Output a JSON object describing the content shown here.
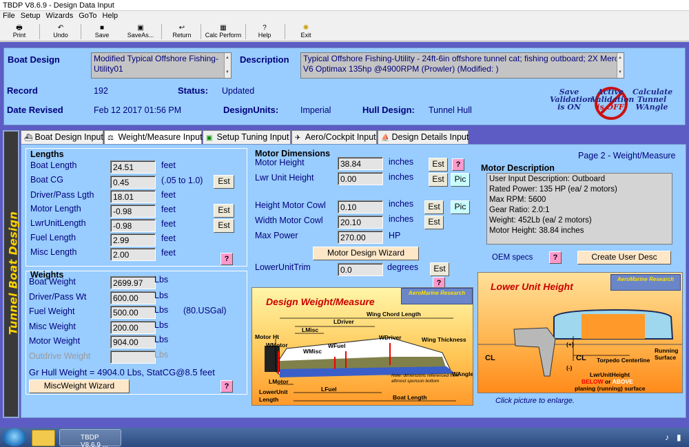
{
  "window": {
    "title": "TBDP V8.6.9 - Design Data Input"
  },
  "menu": [
    "File",
    "Setup",
    "Wizards",
    "GoTo",
    "Help"
  ],
  "toolbar": [
    {
      "label": "Print",
      "icon": "printer-icon",
      "glyph": "🖶"
    },
    {
      "label": "Undo",
      "icon": "undo-icon",
      "glyph": "↶"
    },
    {
      "label": "Save",
      "icon": "floppy-icon",
      "glyph": "■"
    },
    {
      "label": "SaveAs...",
      "icon": "save-as-icon",
      "glyph": "▣"
    },
    {
      "label": "Return",
      "icon": "return-icon",
      "glyph": "↩"
    },
    {
      "label": "Calc Perform",
      "icon": "calc-icon",
      "glyph": "▦"
    },
    {
      "label": "Help",
      "icon": "help-icon",
      "glyph": "?"
    },
    {
      "label": "Exit",
      "icon": "exit-icon",
      "glyph": "✺"
    }
  ],
  "header": {
    "boat_design_label": "Boat Design",
    "boat_design_value": "Modified Typical Offshore Fishing-Utility01",
    "description_label": "Description",
    "description_value": "Typical Offshore Fishing-Utility - 24ft-6in offshore tunnel cat; fishing outboard; 2X Merc V6 Optimax 135hp @4900RPM (Prowler) (Modified: )",
    "record_label": "Record",
    "record_value": "192",
    "status_label": "Status:",
    "status_value": "Updated",
    "date_label": "Date Revised",
    "date_value": "Feb 12 2017 01:56 PM",
    "units_label": "DesignUnits:",
    "units_value": "Imperial",
    "hull_label": "Hull Design:",
    "hull_value": "Tunnel Hull",
    "badges": [
      {
        "line1": "Save",
        "line2": "Validation",
        "line3": "is ON"
      },
      {
        "line1": "Active",
        "line2": "Validation",
        "line3": "is OFF"
      },
      {
        "line1": "Calculate",
        "line2": "Tunnel",
        "line3": "WAngle"
      }
    ]
  },
  "sidebar_title": "Tunnel Boat Design",
  "tabs": [
    {
      "label": "Boat Design Input",
      "icon": "boat-icon",
      "glyph": "⛴"
    },
    {
      "label": "Weight/Measure Input",
      "icon": "scale-icon",
      "glyph": "⚖"
    },
    {
      "label": "Setup Tuning Input",
      "icon": "tuning-icon",
      "glyph": "▣"
    },
    {
      "label": "Aero/Cockpit Input",
      "icon": "aero-icon",
      "glyph": "✈"
    },
    {
      "label": "Design Details Input",
      "icon": "details-icon",
      "glyph": "⛵"
    }
  ],
  "page_title": "Page 2 - Weight/Measure",
  "lengths": {
    "title": "Lengths",
    "rows": [
      {
        "label": "Boat Length",
        "value": "24.51",
        "unit": "feet",
        "btn": ""
      },
      {
        "label": "Boat CG",
        "value": "0.45",
        "unit": "(.05 to 1.0)",
        "btn": "Est"
      },
      {
        "label": "Driver/Pass Lgth",
        "value": "18.01",
        "unit": "feet",
        "btn": ""
      },
      {
        "label": "Motor Length",
        "value": "-0.98",
        "unit": "feet",
        "btn": "Est"
      },
      {
        "label": "LwrUnitLength",
        "value": "-0.98",
        "unit": "feet",
        "btn": "Est"
      },
      {
        "label": "Fuel Length",
        "value": "2.99",
        "unit": "feet",
        "btn": ""
      },
      {
        "label": "Misc Length",
        "value": "2.00",
        "unit": "feet",
        "btn": ""
      }
    ]
  },
  "weights": {
    "title": "Weights",
    "rows": [
      {
        "label": "Boat Weight",
        "value": "2699.97",
        "unit": "Lbs",
        "note": ""
      },
      {
        "label": "Driver/Pass Wt",
        "value": "600.00",
        "unit": "Lbs",
        "note": ""
      },
      {
        "label": "Fuel Weight",
        "value": "500.00",
        "unit": "Lbs",
        "note": "(80.USGal)"
      },
      {
        "label": "Misc Weight",
        "value": "200.00",
        "unit": "Lbs",
        "note": ""
      },
      {
        "label": "Motor Weight",
        "value": "904.00",
        "unit": "Lbs",
        "note": ""
      },
      {
        "label": "Outdrive Weight",
        "value": "",
        "unit": "Lbs",
        "note": ""
      }
    ],
    "summary": "Gr Hull Weight = 4904.0 Lbs, StatCG@8.5 feet",
    "wizard": "MiscWeight Wizard"
  },
  "motor": {
    "title": "Motor Dimensions",
    "height_label": "Motor Height",
    "height_value": "38.84",
    "height_unit": "inches",
    "lwr_label": "Lwr Unit Height",
    "lwr_value": "0.00",
    "lwr_unit": "inches",
    "cowlh_label": "Height Motor Cowl",
    "cowlh_value": "0.10",
    "cowlh_unit": "inches",
    "cowlw_label": "Width Motor Cowl",
    "cowlw_value": "20.10",
    "cowlw_unit": "inches",
    "power_label": "Max Power",
    "power_value": "270.00",
    "power_unit": "HP",
    "wizard": "Motor Design Wizard",
    "trim_label": "LowerUnitTrim",
    "trim_value": "0.0",
    "trim_unit": "degrees",
    "est": "Est",
    "pic": "Pic",
    "q": "?"
  },
  "motor_desc": {
    "title": "Motor Description",
    "lines": [
      "User Input Description: Outboard",
      "Rated Power: 135 HP (ea/ 2 motors)",
      "Max RPM: 5600",
      "Gear Ratio: 2.0:1",
      "Weight: 452Lb (ea/ 2 motors)",
      "Motor Height: 38.84 inches"
    ],
    "oem": "OEM specs",
    "create": "Create User Desc"
  },
  "diagram1": {
    "title": "Design Weight/Measure",
    "logo1": "AeroMarine Research",
    "labels": {
      "wingchord": "Wing Chord Length",
      "ldriver": "LDriver",
      "lmisc": "LMisc",
      "motorht": "Motor Ht",
      "wmotor": "WMotor",
      "wfuel": "WFuel",
      "wdriver": "WDriver",
      "wingthick": "Wing Thickness",
      "wmisc": "WMisc",
      "wangle": "WAngle",
      "lmotor": "LMotor",
      "lowerunit": "LowerUnit Length",
      "lfuel": "LFuel",
      "boatlength": "Boat Length",
      "note": "Note: dimensions referenced from aftmost sponson bottom"
    }
  },
  "diagram2": {
    "title": "Lower Unit Height",
    "logo1": "AeroMarine Research",
    "labels": {
      "plus": "(+)",
      "minus": "(-)",
      "running": "Running Surface",
      "cl1": "CL",
      "cl2": "CL",
      "torpedo": "Torpedo Centerline",
      "lwr": "LwrUnitHeight",
      "below": "BELOW",
      "or": "or",
      "above": "ABOVE",
      "planing": "planing (running) surface"
    },
    "caption": "Click picture to enlarge."
  },
  "taskbar": {
    "app": "TBDP V8.6.9 ..."
  },
  "colors": {
    "page_bg": "#99ccff",
    "frame": "#5c5cc4",
    "label": "#00007a",
    "sidebar_text": "#ffd200"
  }
}
